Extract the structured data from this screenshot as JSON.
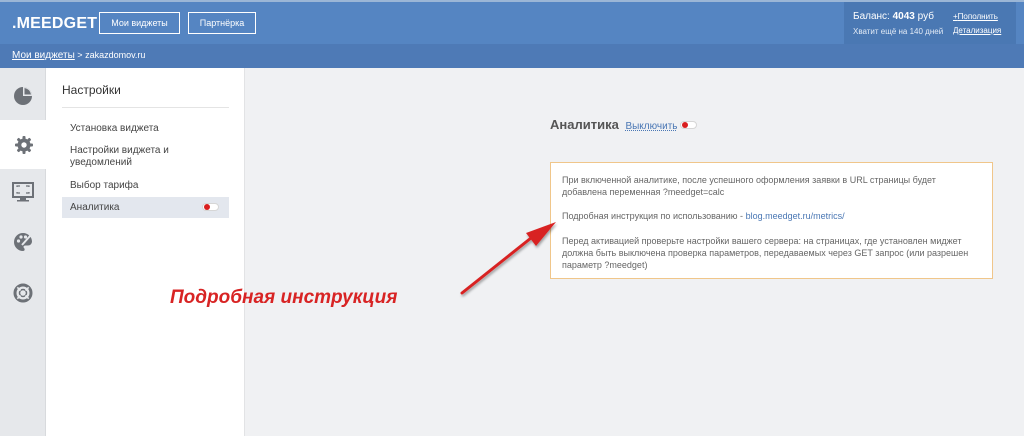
{
  "header": {
    "logo": ".MEEDGET",
    "btn_widgets": "Мои виджеты",
    "btn_partner": "Партнёрка",
    "balance_label": "Баланс:",
    "balance_value": "4043",
    "balance_currency": "руб",
    "balance_days": "Хватит ещё на 140 дней",
    "topup_link": "Пополнить",
    "details_link": "Детализация"
  },
  "breadcrumb": {
    "root": "Мои виджеты",
    "separator": " > ",
    "site": "zakazdomov.ru"
  },
  "rail": {
    "icons": [
      "chart-pie-icon",
      "gear-icon",
      "screen-icon",
      "palette-icon",
      "lifebuoy-icon"
    ]
  },
  "sidebar": {
    "title": "Настройки",
    "items": [
      {
        "label": "Установка виджета"
      },
      {
        "label": "Настройки виджета и уведомлений"
      },
      {
        "label": "Выбор тарифа"
      },
      {
        "label": "Аналитика"
      }
    ]
  },
  "main": {
    "heading": "Аналитика",
    "toggle_link": "Выключить",
    "para1": "При включенной аналитике, после успешного оформления заявки в URL страницы будет добавлена переменная ?meedget=calc",
    "para2_text": "Подробная инструкция по использованию - ",
    "para2_link": "blog.meedget.ru/metrics/",
    "para3": "Перед активацией проверьте настройки вашего сервера: на страницах, где установлен миджет должна быть выключена проверка параметров, передаваемых через GET запрос (или разрешен параметр ?meedget)"
  },
  "annotation": {
    "text": "Подробная инструкция",
    "color": "#d82424"
  },
  "colors": {
    "header": "#5585c2",
    "subbar": "#4e7ab6",
    "toggle_dot": "#d91f1f",
    "info_border": "#f0c68a"
  }
}
